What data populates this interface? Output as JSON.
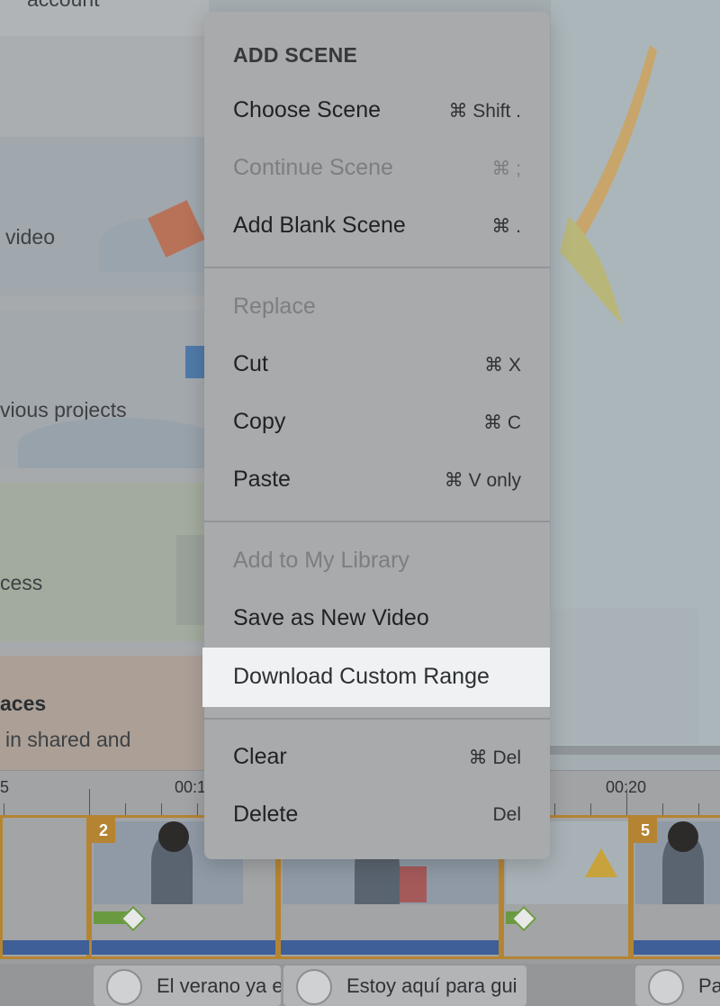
{
  "background": {
    "cards": [
      {
        "text": "account"
      },
      {
        "text": "video"
      },
      {
        "text": "vious projects"
      },
      {
        "text": "cess"
      },
      {
        "title": "aces",
        "text": "in shared and"
      }
    ]
  },
  "context_menu": {
    "heading": "ADD SCENE",
    "items": [
      {
        "label": "Choose Scene",
        "shortcut": "⌘ Shift .",
        "enabled": true
      },
      {
        "label": "Continue Scene",
        "shortcut": "⌘ ;",
        "enabled": false
      },
      {
        "label": "Add Blank Scene",
        "shortcut": "⌘ .",
        "enabled": true
      },
      {
        "label": "Replace",
        "shortcut": "",
        "enabled": false
      },
      {
        "label": "Cut",
        "shortcut": "⌘ X",
        "enabled": true
      },
      {
        "label": "Copy",
        "shortcut": "⌘ C",
        "enabled": true
      },
      {
        "label": "Paste",
        "shortcut": "⌘ V only",
        "enabled": true
      },
      {
        "label": "Add to My Library",
        "shortcut": "",
        "enabled": false
      },
      {
        "label": "Save as New Video",
        "shortcut": "",
        "enabled": true
      },
      {
        "label": "Download Custom Range",
        "shortcut": "",
        "enabled": true,
        "highlighted": true
      },
      {
        "label": "Clear",
        "shortcut": "⌘ Del",
        "enabled": true
      },
      {
        "label": "Delete",
        "shortcut": "Del",
        "enabled": true
      }
    ]
  },
  "ruler": {
    "labels": [
      "5",
      "00:1",
      "00:20"
    ]
  },
  "timeline": {
    "scenes": [
      {
        "number": "2"
      },
      {
        "number": "5"
      }
    ]
  },
  "audio": {
    "clips": [
      {
        "text": "El verano ya e"
      },
      {
        "text": "Estoy aquí para gui"
      },
      {
        "text": "Pa"
      }
    ]
  },
  "colors": {
    "menu_bg": "#a8aaab",
    "highlight_bg": "#eff1f2",
    "scene_border": "#b58432",
    "track_blue": "#3e5f97"
  }
}
